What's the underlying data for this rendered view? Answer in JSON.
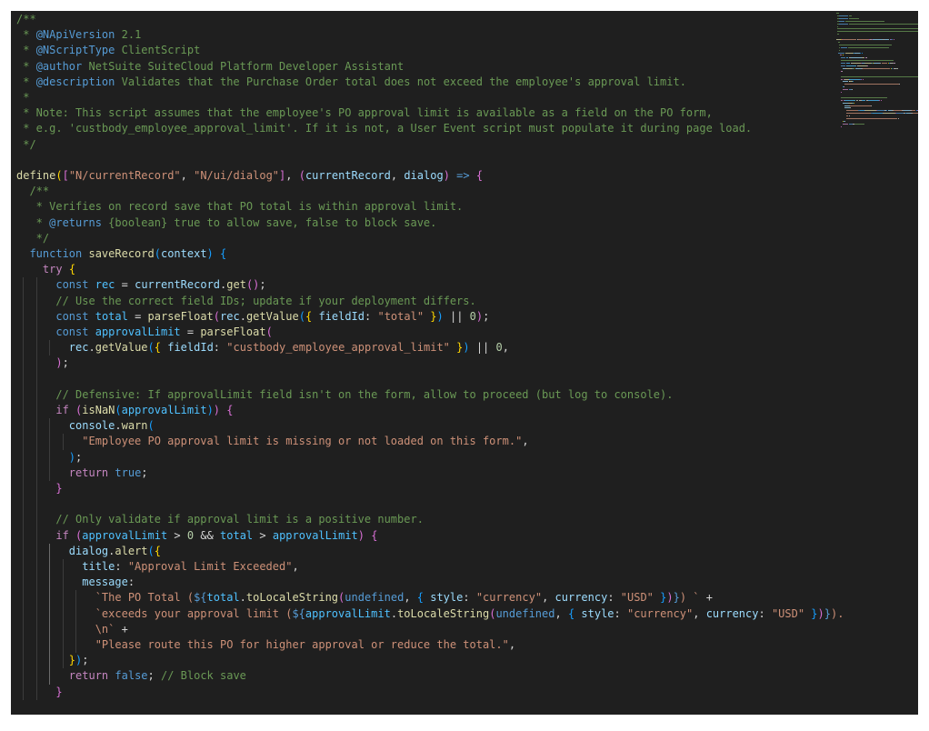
{
  "editor": {
    "language": "javascript",
    "theme_colors": {
      "background": "#1f1f1f",
      "comment": "#6a9955",
      "keyword": "#569cd6",
      "control": "#c586c0",
      "string": "#ce9178",
      "number": "#b5cea8",
      "function": "#dcdcaa",
      "variable": "#9cdcfe",
      "default": "#d4d4d4"
    },
    "lines": [
      [
        [
          "cm",
          "/**"
        ]
      ],
      [
        [
          "cm",
          " * "
        ],
        [
          "tag",
          "@NApiVersion"
        ],
        [
          "cm",
          " 2.1"
        ]
      ],
      [
        [
          "cm",
          " * "
        ],
        [
          "tag",
          "@NScriptType"
        ],
        [
          "cm",
          " ClientScript"
        ]
      ],
      [
        [
          "cm",
          " * "
        ],
        [
          "tag",
          "@author"
        ],
        [
          "cm",
          " NetSuite SuiteCloud Platform Developer Assistant"
        ]
      ],
      [
        [
          "cm",
          " * "
        ],
        [
          "tag",
          "@description"
        ],
        [
          "cm",
          " Validates that the Purchase Order total does not exceed the employee's approval limit."
        ]
      ],
      [
        [
          "cm",
          " *"
        ]
      ],
      [
        [
          "cm",
          " * Note: This script assumes that the employee's PO approval limit is available as a field on the PO form,"
        ]
      ],
      [
        [
          "cm",
          " * e.g. 'custbody_employee_approval_limit'. If it is not, a User Event script must populate it during page load."
        ]
      ],
      [
        [
          "cm",
          " */"
        ]
      ],
      [],
      [
        [
          "fn",
          "define"
        ],
        [
          "br1",
          "("
        ],
        [
          "br2",
          "["
        ],
        [
          "str",
          "\"N/currentRecord\""
        ],
        [
          "txt",
          ", "
        ],
        [
          "str",
          "\"N/ui/dialog\""
        ],
        [
          "br2",
          "]"
        ],
        [
          "txt",
          ", "
        ],
        [
          "br2",
          "("
        ],
        [
          "var",
          "currentRecord"
        ],
        [
          "txt",
          ", "
        ],
        [
          "var",
          "dialog"
        ],
        [
          "br2",
          ")"
        ],
        [
          "txt",
          " "
        ],
        [
          "kw",
          "=>"
        ],
        [
          "txt",
          " "
        ],
        [
          "br2",
          "{"
        ]
      ],
      [
        [
          "cm",
          "  /**"
        ]
      ],
      [
        [
          "cm",
          "   * Verifies on record save that PO total is within approval limit."
        ]
      ],
      [
        [
          "cm",
          "   * "
        ],
        [
          "tag",
          "@returns"
        ],
        [
          "cm",
          " {boolean} true to allow save, false to block save."
        ]
      ],
      [
        [
          "cm",
          "   */"
        ]
      ],
      [
        [
          "txt",
          "  "
        ],
        [
          "kw",
          "function"
        ],
        [
          "txt",
          " "
        ],
        [
          "fn",
          "saveRecord"
        ],
        [
          "br3",
          "("
        ],
        [
          "var",
          "context"
        ],
        [
          "br3",
          ")"
        ],
        [
          "txt",
          " "
        ],
        [
          "br3",
          "{"
        ]
      ],
      [
        [
          "txt",
          "    "
        ],
        [
          "ctl",
          "try"
        ],
        [
          "txt",
          " "
        ],
        [
          "br1",
          "{"
        ]
      ],
      [
        [
          "txt",
          "      "
        ],
        [
          "kw",
          "const"
        ],
        [
          "txt",
          " "
        ],
        [
          "cst",
          "rec"
        ],
        [
          "txt",
          " = "
        ],
        [
          "var",
          "currentRecord"
        ],
        [
          "txt",
          "."
        ],
        [
          "fn",
          "get"
        ],
        [
          "br2",
          "()"
        ],
        [
          "txt",
          ";"
        ]
      ],
      [
        [
          "cm",
          "      // Use the correct field IDs; update if your deployment differs."
        ]
      ],
      [
        [
          "txt",
          "      "
        ],
        [
          "kw",
          "const"
        ],
        [
          "txt",
          " "
        ],
        [
          "cst",
          "total"
        ],
        [
          "txt",
          " = "
        ],
        [
          "fn",
          "parseFloat"
        ],
        [
          "br2",
          "("
        ],
        [
          "var",
          "rec"
        ],
        [
          "txt",
          "."
        ],
        [
          "fn",
          "getValue"
        ],
        [
          "br3",
          "("
        ],
        [
          "br1",
          "{"
        ],
        [
          "txt",
          " "
        ],
        [
          "var",
          "fieldId"
        ],
        [
          "txt",
          ": "
        ],
        [
          "str",
          "\"total\""
        ],
        [
          "txt",
          " "
        ],
        [
          "br1",
          "}"
        ],
        [
          "br3",
          ")"
        ],
        [
          "txt",
          " || "
        ],
        [
          "num",
          "0"
        ],
        [
          "br2",
          ")"
        ],
        [
          "txt",
          ";"
        ]
      ],
      [
        [
          "txt",
          "      "
        ],
        [
          "kw",
          "const"
        ],
        [
          "txt",
          " "
        ],
        [
          "cst",
          "approvalLimit"
        ],
        [
          "txt",
          " = "
        ],
        [
          "fn",
          "parseFloat"
        ],
        [
          "br2",
          "("
        ]
      ],
      [
        [
          "txt",
          "        "
        ],
        [
          "var",
          "rec"
        ],
        [
          "txt",
          "."
        ],
        [
          "fn",
          "getValue"
        ],
        [
          "br3",
          "("
        ],
        [
          "br1",
          "{"
        ],
        [
          "txt",
          " "
        ],
        [
          "var",
          "fieldId"
        ],
        [
          "txt",
          ": "
        ],
        [
          "str",
          "\"custbody_employee_approval_limit\""
        ],
        [
          "txt",
          " "
        ],
        [
          "br1",
          "}"
        ],
        [
          "br3",
          ")"
        ],
        [
          "txt",
          " || "
        ],
        [
          "num",
          "0"
        ],
        [
          "txt",
          ","
        ]
      ],
      [
        [
          "txt",
          "      "
        ],
        [
          "br2",
          ")"
        ],
        [
          "txt",
          ";"
        ]
      ],
      [],
      [
        [
          "cm",
          "      // Defensive: If approvalLimit field isn't on the form, allow to proceed (but log to console)."
        ]
      ],
      [
        [
          "txt",
          "      "
        ],
        [
          "ctl",
          "if"
        ],
        [
          "txt",
          " "
        ],
        [
          "br2",
          "("
        ],
        [
          "fn",
          "isNaN"
        ],
        [
          "br3",
          "("
        ],
        [
          "cst",
          "approvalLimit"
        ],
        [
          "br3",
          ")"
        ],
        [
          "br2",
          ")"
        ],
        [
          "txt",
          " "
        ],
        [
          "br2",
          "{"
        ]
      ],
      [
        [
          "txt",
          "        "
        ],
        [
          "var",
          "console"
        ],
        [
          "txt",
          "."
        ],
        [
          "fn",
          "warn"
        ],
        [
          "br3",
          "("
        ]
      ],
      [
        [
          "txt",
          "          "
        ],
        [
          "str",
          "\"Employee PO approval limit is missing or not loaded on this form.\""
        ],
        [
          "txt",
          ","
        ]
      ],
      [
        [
          "txt",
          "        "
        ],
        [
          "br3",
          ")"
        ],
        [
          "txt",
          ";"
        ]
      ],
      [
        [
          "txt",
          "        "
        ],
        [
          "ctl",
          "return"
        ],
        [
          "txt",
          " "
        ],
        [
          "kw",
          "true"
        ],
        [
          "txt",
          ";"
        ]
      ],
      [
        [
          "txt",
          "      "
        ],
        [
          "br2",
          "}"
        ]
      ],
      [],
      [
        [
          "cm",
          "      // Only validate if approval limit is a positive number."
        ]
      ],
      [
        [
          "txt",
          "      "
        ],
        [
          "ctl",
          "if"
        ],
        [
          "txt",
          " "
        ],
        [
          "br2",
          "("
        ],
        [
          "cst",
          "approvalLimit"
        ],
        [
          "txt",
          " > "
        ],
        [
          "num",
          "0"
        ],
        [
          "txt",
          " && "
        ],
        [
          "cst",
          "total"
        ],
        [
          "txt",
          " > "
        ],
        [
          "cst",
          "approvalLimit"
        ],
        [
          "br2",
          ")"
        ],
        [
          "txt",
          " "
        ],
        [
          "br2",
          "{"
        ]
      ],
      [
        [
          "txt",
          "        "
        ],
        [
          "var",
          "dialog"
        ],
        [
          "txt",
          "."
        ],
        [
          "fn",
          "alert"
        ],
        [
          "br3",
          "("
        ],
        [
          "br1",
          "{"
        ]
      ],
      [
        [
          "txt",
          "          "
        ],
        [
          "var",
          "title"
        ],
        [
          "txt",
          ": "
        ],
        [
          "str",
          "\"Approval Limit Exceeded\""
        ],
        [
          "txt",
          ","
        ]
      ],
      [
        [
          "txt",
          "          "
        ],
        [
          "var",
          "message"
        ],
        [
          "txt",
          ":"
        ]
      ],
      [
        [
          "txt",
          "            "
        ],
        [
          "str",
          "`The PO Total ("
        ],
        [
          "kw",
          "${"
        ],
        [
          "cst",
          "total"
        ],
        [
          "txt",
          "."
        ],
        [
          "fn",
          "toLocaleString"
        ],
        [
          "br2",
          "("
        ],
        [
          "kw",
          "undefined"
        ],
        [
          "txt",
          ", "
        ],
        [
          "br3",
          "{"
        ],
        [
          "txt",
          " "
        ],
        [
          "var",
          "style"
        ],
        [
          "txt",
          ": "
        ],
        [
          "str",
          "\"currency\""
        ],
        [
          "txt",
          ", "
        ],
        [
          "var",
          "currency"
        ],
        [
          "txt",
          ": "
        ],
        [
          "str",
          "\"USD\""
        ],
        [
          "txt",
          " "
        ],
        [
          "br3",
          "}"
        ],
        [
          "br2",
          ")"
        ],
        [
          "kw",
          "}"
        ],
        [
          "str",
          ") `"
        ],
        [
          "txt",
          " +"
        ]
      ],
      [
        [
          "txt",
          "            "
        ],
        [
          "str",
          "`exceeds your approval limit ("
        ],
        [
          "kw",
          "${"
        ],
        [
          "cst",
          "approvalLimit"
        ],
        [
          "txt",
          "."
        ],
        [
          "fn",
          "toLocaleString"
        ],
        [
          "br2",
          "("
        ],
        [
          "kw",
          "undefined"
        ],
        [
          "txt",
          ", "
        ],
        [
          "br3",
          "{"
        ],
        [
          "txt",
          " "
        ],
        [
          "var",
          "style"
        ],
        [
          "txt",
          ": "
        ],
        [
          "str",
          "\"currency\""
        ],
        [
          "txt",
          ", "
        ],
        [
          "var",
          "currency"
        ],
        [
          "txt",
          ": "
        ],
        [
          "str",
          "\"USD\""
        ],
        [
          "txt",
          " "
        ],
        [
          "br3",
          "}"
        ],
        [
          "br2",
          ")"
        ],
        [
          "kw",
          "}"
        ],
        [
          "str",
          ")."
        ]
      ],
      [
        [
          "txt",
          "            "
        ],
        [
          "str",
          "\\n`"
        ],
        [
          "txt",
          " +"
        ]
      ],
      [
        [
          "txt",
          "            "
        ],
        [
          "str",
          "\"Please route this PO for higher approval or reduce the total.\""
        ],
        [
          "txt",
          ","
        ]
      ],
      [
        [
          "txt",
          "        "
        ],
        [
          "br1",
          "}"
        ],
        [
          "br3",
          ")"
        ],
        [
          "txt",
          ";"
        ]
      ],
      [
        [
          "txt",
          "        "
        ],
        [
          "ctl",
          "return"
        ],
        [
          "txt",
          " "
        ],
        [
          "kw",
          "false"
        ],
        [
          "txt",
          "; "
        ],
        [
          "cm",
          "// Block save"
        ]
      ],
      [
        [
          "txt",
          "      "
        ],
        [
          "br2",
          "}"
        ]
      ]
    ]
  },
  "minimap": {
    "label": "code minimap"
  }
}
